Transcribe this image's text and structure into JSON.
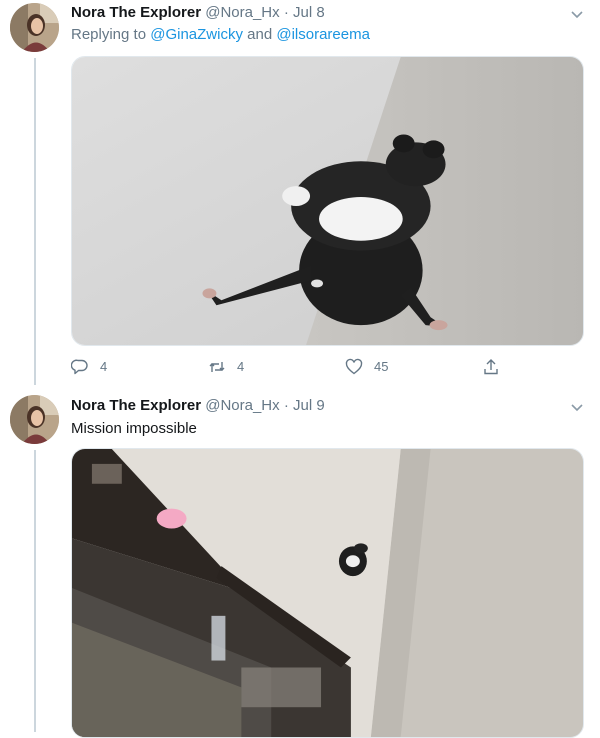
{
  "tweets": [
    {
      "name": "Nora The Explorer",
      "handle": "@Nora_Hx",
      "separator": "·",
      "date": "Jul 8",
      "replying_prefix": "Replying to",
      "mention_1": "@GinaZwicky",
      "and_word": "and",
      "mention_2": "@ilsorareema",
      "actions": {
        "reply_count": "4",
        "retweet_count": "4",
        "like_count": "45"
      },
      "icons": [
        "chevron-down-icon",
        "reply-icon",
        "retweet-icon",
        "like-icon",
        "share-icon"
      ]
    },
    {
      "name": "Nora The Explorer",
      "handle": "@Nora_Hx",
      "separator": "·",
      "date": "Jul 9",
      "text": "Mission impossible",
      "icons": [
        "chevron-down-icon"
      ]
    }
  ],
  "colors": {
    "name": "#14171a",
    "secondary": "#657786",
    "link": "#1b95e0",
    "thread_line": "#ccd6dd"
  }
}
